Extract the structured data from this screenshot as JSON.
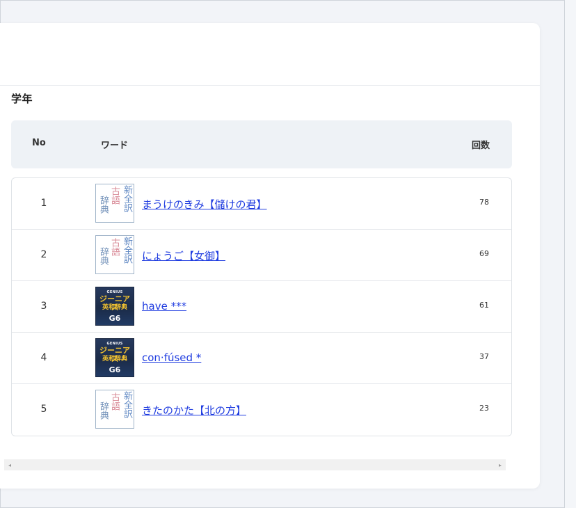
{
  "section": {
    "title": "学年"
  },
  "table": {
    "headers": {
      "no": "No",
      "word": "ワード",
      "count": "回数"
    },
    "rows": [
      {
        "no": "1",
        "word": "まうけのきみ【儲けの君】",
        "count": "78",
        "thumb": {
          "type": "kogo",
          "c1": "辞典",
          "c2": "古語",
          "c3": "新全訳"
        }
      },
      {
        "no": "2",
        "word": "にょうご【女御】",
        "count": "69",
        "thumb": {
          "type": "kogo",
          "c1": "辞典",
          "c2": "古語",
          "c3": "新全訳"
        }
      },
      {
        "no": "3",
        "word": "have ***",
        "count": "61",
        "thumb": {
          "type": "genius",
          "top": "GENIUS",
          "mid": "ジーニアス",
          "mid2": "英和辞典",
          "bot": "G6"
        }
      },
      {
        "no": "4",
        "word": "con·fúsed *",
        "count": "37",
        "thumb": {
          "type": "genius",
          "top": "GENIUS",
          "mid": "ジーニアス",
          "mid2": "英和辞典",
          "bot": "G6"
        }
      },
      {
        "no": "5",
        "word": "きたのかた【北の方】",
        "count": "23",
        "thumb": {
          "type": "kogo",
          "c1": "辞典",
          "c2": "古語",
          "c3": "新全訳"
        }
      }
    ]
  },
  "scrollbar": {
    "left_arrow": "◂",
    "right_arrow": "▸"
  },
  "colors": {
    "link": "#1f3ce0",
    "header_bg": "#eef2f6",
    "page_bg": "#f2f4f8"
  }
}
